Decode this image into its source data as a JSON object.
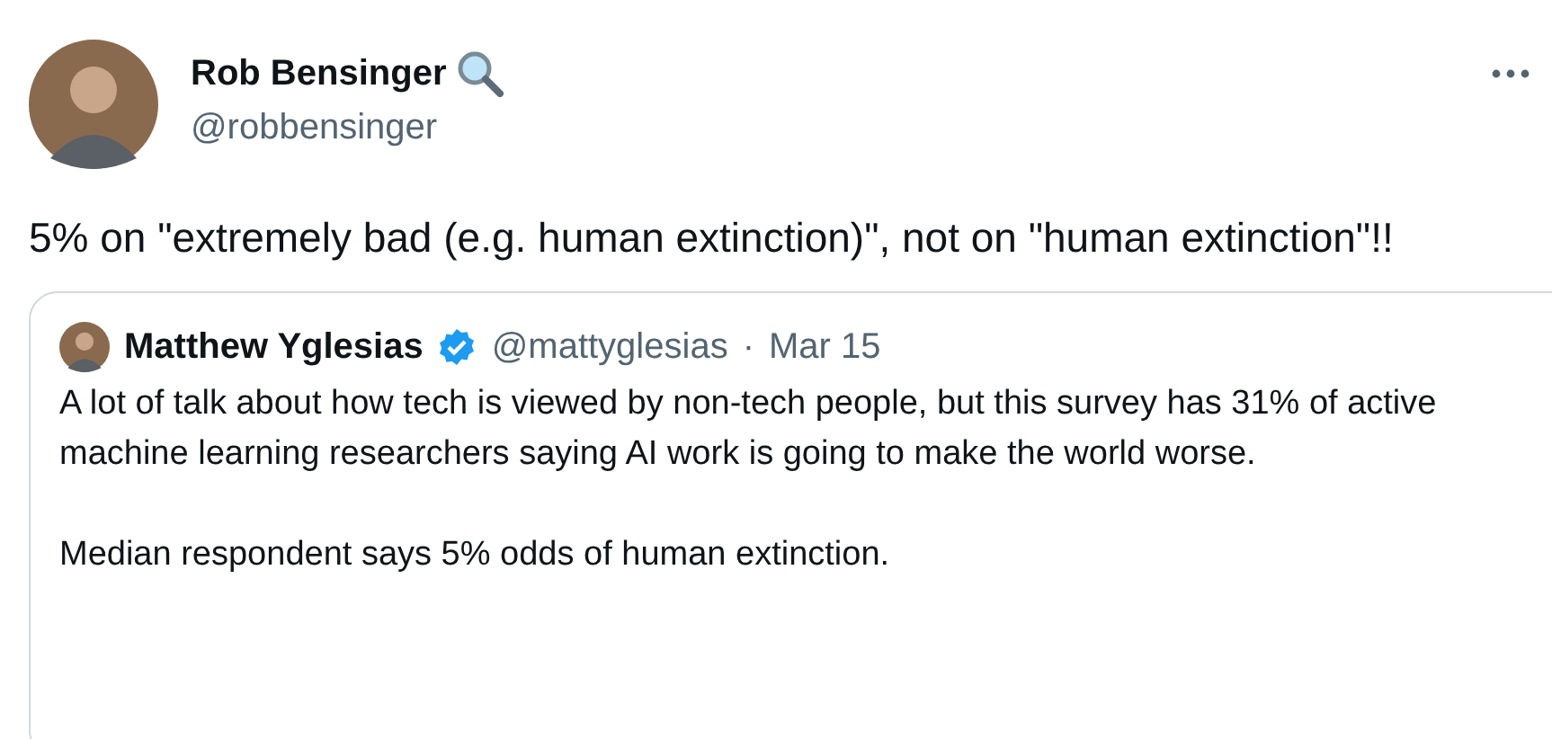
{
  "author": {
    "name": "Rob Bensinger",
    "handle": "@robbensinger"
  },
  "text": "5% on \"extremely bad (e.g. human extinction)\", not on \"human extinction\"!!",
  "quote": {
    "author": {
      "name": "Matthew Yglesias",
      "verified": true,
      "handle": "@mattyglesias",
      "separator": "·",
      "date": "Mar 15"
    },
    "paragraphs": [
      "A lot of talk about how tech is viewed by non-tech people, but this survey has 31% of active machine learning researchers saying AI work is going to make the world worse.",
      "Median respondent says 5% odds of human extinction."
    ]
  }
}
